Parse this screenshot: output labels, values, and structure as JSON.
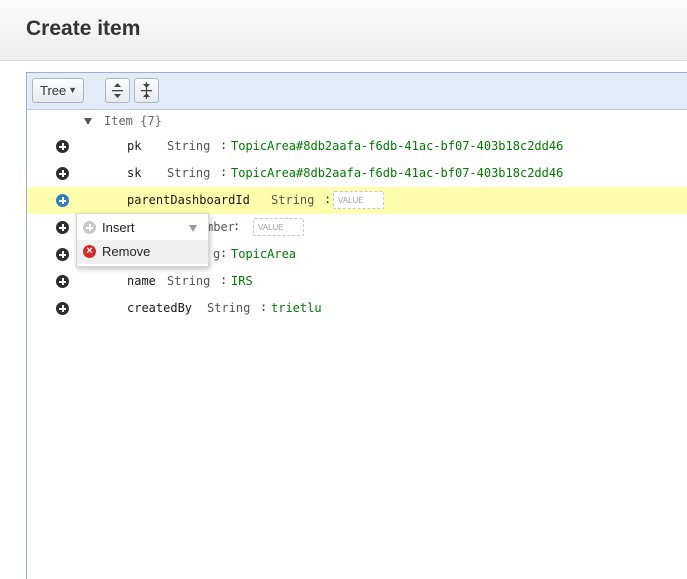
{
  "header": {
    "title": "Create item"
  },
  "toolbar": {
    "mode_label": "Tree",
    "expand_all_icon": "expand-all-icon",
    "collapse_all_icon": "collapse-all-icon"
  },
  "tree": {
    "root_label": "Item {7}",
    "rows": [
      {
        "name": "pk",
        "type": "String",
        "value": "TopicArea#8db2aafa-f6db-41ac-bf07-403b18c2dd46"
      },
      {
        "name": "sk",
        "type": "String",
        "value": "TopicArea#8db2aafa-f6db-41ac-bf07-403b18c2dd46"
      },
      {
        "name": "parentDashboardId",
        "type": "String",
        "placeholder": "VALUE"
      },
      {
        "name_partial": "mber",
        "placeholder": "VALUE"
      },
      {
        "type_partial": "g",
        "value": "TopicArea"
      },
      {
        "name": "name",
        "type": "String",
        "value": "IRS"
      },
      {
        "name": "createdBy",
        "type": "String",
        "value": "trietlu"
      }
    ]
  },
  "context_menu": {
    "insert_label": "Insert",
    "remove_label": "Remove"
  },
  "colors": {
    "accent_blue": "#2f7bd0",
    "highlight_row": "#ffffab",
    "value_green": "#007a00",
    "remove_red": "#d42a2a"
  }
}
